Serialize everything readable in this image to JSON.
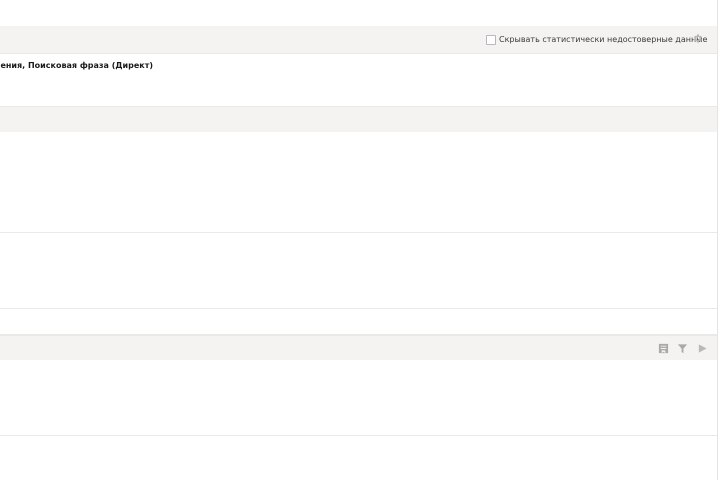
{
  "settings": {
    "hide_unreliable_label": "Скрывать статистически недостоверные данные",
    "hide_unreliable_checked": false
  },
  "grouping": {
    "text": "Объявления, Поисковая фраза (Директ)"
  },
  "icons": {
    "settings": "gear-icon",
    "save_segment": "bookmark-icon",
    "filter": "filter-icon",
    "expand": "play-icon"
  },
  "colors": {
    "panel_bg": "#f4f3f1",
    "divider": "#ebe9e6",
    "icon_gray": "#a9a9a9",
    "text_dark": "#1a1a1a"
  }
}
